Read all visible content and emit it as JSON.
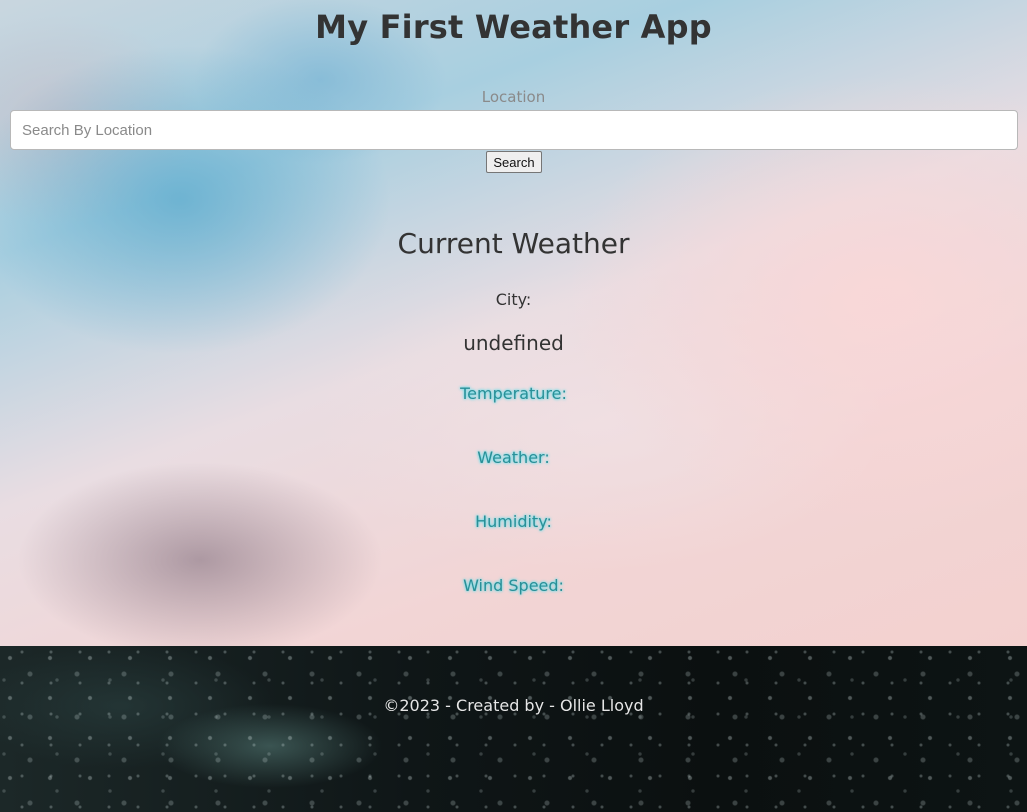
{
  "header": {
    "title": "My First Weather App"
  },
  "search": {
    "label": "Location",
    "placeholder": "Search By Location",
    "value": "",
    "button_label": "Search"
  },
  "current_weather": {
    "title": "Current Weather",
    "city_label": "City:",
    "city_value": "undefined",
    "temperature_label": "Temperature:",
    "weather_label": "Weather:",
    "humidity_label": "Humidity:",
    "wind_speed_label": "Wind Speed:"
  },
  "footer": {
    "text": "©2023 - Created by - Ollie Lloyd"
  },
  "colors": {
    "text_dark": "#333333",
    "accent_cyan": "#2a8f97",
    "footer_bg": "#0f1617"
  }
}
